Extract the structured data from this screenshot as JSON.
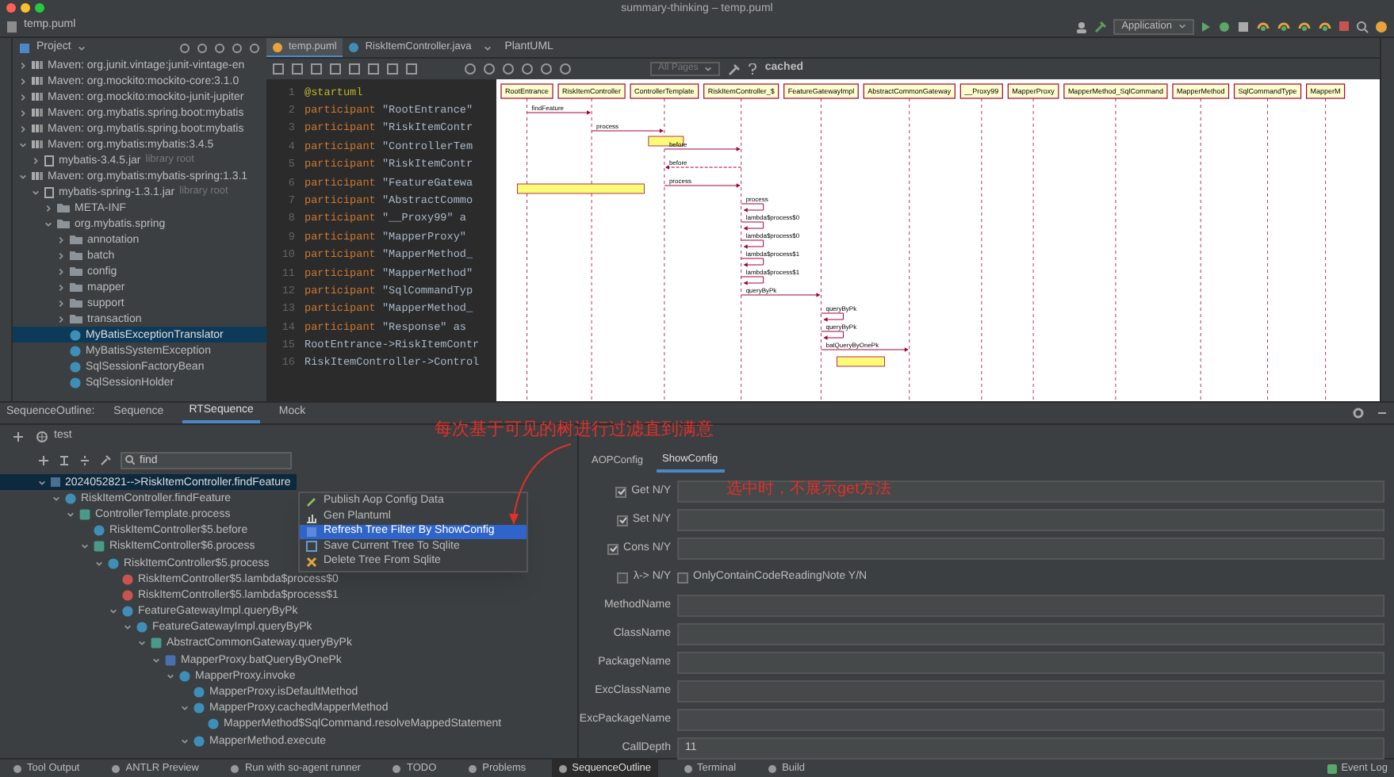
{
  "window": {
    "title": "summary-thinking – temp.puml"
  },
  "navigation_bar": {
    "breadcrumb": "temp.puml",
    "run_configuration": "Application"
  },
  "project_panel": {
    "title": "Project",
    "items": [
      {
        "label": "Maven: org.junit.vintage:junit-vintage-en",
        "kind": "library",
        "expanded": false,
        "selected": false
      },
      {
        "label": "Maven: org.mockito:mockito-core:3.1.0",
        "kind": "library",
        "expanded": false,
        "selected": false
      },
      {
        "label": "Maven: org.mockito:mockito-junit-jupiter",
        "kind": "library",
        "expanded": false,
        "selected": false
      },
      {
        "label": "Maven: org.mybatis.spring.boot:mybatis",
        "kind": "library",
        "expanded": false,
        "selected": false
      },
      {
        "label": "Maven: org.mybatis.spring.boot:mybatis",
        "kind": "library",
        "expanded": false,
        "selected": false
      },
      {
        "label": "Maven: org.mybatis:mybatis:3.4.5",
        "kind": "library",
        "expanded": true,
        "selected": false,
        "children": [
          {
            "label": "mybatis-3.4.5.jar",
            "note": "library root",
            "kind": "jar",
            "expanded": false,
            "selected": false
          }
        ]
      },
      {
        "label": "Maven: org.mybatis:mybatis-spring:1.3.1",
        "kind": "library",
        "expanded": true,
        "selected": false,
        "children": [
          {
            "label": "mybatis-spring-1.3.1.jar",
            "note": "library root",
            "kind": "jar",
            "expanded": true,
            "selected": false,
            "children": [
              {
                "label": "META-INF",
                "kind": "folder",
                "expanded": false,
                "selected": false
              },
              {
                "label": "org.mybatis.spring",
                "kind": "folder",
                "expanded": true,
                "selected": false,
                "children": [
                  {
                    "label": "annotation",
                    "kind": "folder",
                    "expanded": false,
                    "selected": false
                  },
                  {
                    "label": "batch",
                    "kind": "folder",
                    "expanded": false,
                    "selected": false
                  },
                  {
                    "label": "config",
                    "kind": "folder",
                    "expanded": false,
                    "selected": false
                  },
                  {
                    "label": "mapper",
                    "kind": "folder",
                    "expanded": false,
                    "selected": false
                  },
                  {
                    "label": "support",
                    "kind": "folder",
                    "expanded": false,
                    "selected": false
                  },
                  {
                    "label": "transaction",
                    "kind": "folder",
                    "expanded": false,
                    "selected": false
                  },
                  {
                    "label": "MyBatisExceptionTranslator",
                    "kind": "class",
                    "selected": true
                  },
                  {
                    "label": "MyBatisSystemException",
                    "kind": "class",
                    "selected": false
                  },
                  {
                    "label": "SqlSessionFactoryBean",
                    "kind": "class",
                    "selected": false
                  },
                  {
                    "label": "SqlSessionHolder",
                    "kind": "class",
                    "selected": false
                  }
                ]
              }
            ]
          }
        ]
      }
    ]
  },
  "editor": {
    "tabs": [
      {
        "label": "temp.puml",
        "selected": true
      },
      {
        "label": "RiskItemController.java",
        "selected": false
      }
    ],
    "preview_title": "PlantUML",
    "lines": [
      {
        "number": "1",
        "kind": "directive",
        "text": "@startuml"
      },
      {
        "number": "2",
        "kind": "participant",
        "keyword": "participant",
        "text": "\"RootEntrance\""
      },
      {
        "number": "3",
        "kind": "participant",
        "keyword": "participant",
        "text": "\"RiskItemContr"
      },
      {
        "number": "4",
        "kind": "participant",
        "keyword": "participant",
        "text": "\"ControllerTem"
      },
      {
        "number": "5",
        "kind": "participant",
        "keyword": "participant",
        "text": "\"RiskItemContr"
      },
      {
        "number": "6",
        "kind": "participant",
        "keyword": "participant",
        "text": "\"FeatureGatewa"
      },
      {
        "number": "7",
        "kind": "participant",
        "keyword": "participant",
        "text": "\"AbstractCommo"
      },
      {
        "number": "8",
        "kind": "participant",
        "keyword": "participant",
        "text": "\"__Proxy99\" a"
      },
      {
        "number": "9",
        "kind": "participant",
        "keyword": "participant",
        "text": "\"MapperProxy\""
      },
      {
        "number": "10",
        "kind": "participant",
        "keyword": "participant",
        "text": "\"MapperMethod_"
      },
      {
        "number": "11",
        "kind": "participant",
        "keyword": "participant",
        "text": "\"MapperMethod\""
      },
      {
        "number": "12",
        "kind": "participant",
        "keyword": "participant",
        "text": "\"SqlCommandTyp"
      },
      {
        "number": "13",
        "kind": "participant",
        "keyword": "participant",
        "text": "\"MapperMethod_"
      },
      {
        "number": "14",
        "kind": "participant",
        "keyword": "participant",
        "text": "\"Response\" as"
      },
      {
        "number": "15",
        "kind": "plain",
        "text": "RootEntrance->RiskItemContr"
      },
      {
        "number": "16",
        "kind": "plain",
        "text": "RiskItemController->Control"
      }
    ]
  },
  "plantuml": {
    "page_selector": "All Pages",
    "status": "cached",
    "participants": [
      "RootEntrance",
      "RiskItemController",
      "ControllerTemplate",
      "RiskItemController_$",
      "FeatureGatewayImpl",
      "AbstractCommonGateway",
      "__Proxy99",
      "MapperProxy",
      "MapperMethod_SqlCommand",
      "MapperMethod",
      "SqlCommandType",
      "MapperM"
    ],
    "messages": [
      {
        "label": "findFeature"
      },
      {
        "label": "process"
      },
      {
        "label": "before"
      },
      {
        "label": "before"
      },
      {
        "label": "process"
      },
      {
        "label": "process"
      },
      {
        "label": "lambda$process$0"
      },
      {
        "label": "lambda$process$0"
      },
      {
        "label": "lambda$process$1"
      },
      {
        "label": "lambda$process$1"
      },
      {
        "label": "queryByPk"
      },
      {
        "label": "queryByPk"
      },
      {
        "label": "queryByPk"
      },
      {
        "label": "batQueryByOnePk"
      }
    ]
  },
  "bottom_panel": {
    "title": "SequenceOutline:",
    "tabs": [
      {
        "label": "Sequence",
        "selected": false
      },
      {
        "label": "RTSequence",
        "selected": true
      },
      {
        "label": "Mock",
        "selected": false
      }
    ],
    "session": "test",
    "filter": {
      "value": "find"
    },
    "tree": [
      {
        "label": "2024052821-->RiskItemController.findFeature",
        "kind": "root",
        "expanded": true,
        "selected": true,
        "children": [
          {
            "label": "RiskItemController.findFeature",
            "kind": "class",
            "expanded": true,
            "selected": false,
            "children": [
              {
                "label": "ControllerTemplate.process",
                "kind": "abstract",
                "expanded": true,
                "selected": false,
                "children": [
                  {
                    "label": "RiskItemController$5.before",
                    "kind": "class",
                    "selected": false
                  },
                  {
                    "label": "RiskItemController$6.process",
                    "kind": "abstract",
                    "expanded": true,
                    "selected": false,
                    "children": [
                      {
                        "label": "RiskItemController$5.process",
                        "kind": "class",
                        "expanded": true,
                        "selected": false,
                        "children": [
                          {
                            "label": "RiskItemController$5.lambda$process$0",
                            "kind": "lambda",
                            "selected": false
                          },
                          {
                            "label": "RiskItemController$5.lambda$process$1",
                            "kind": "lambda",
                            "selected": false
                          },
                          {
                            "label": "FeatureGatewayImpl.queryByPk",
                            "kind": "class",
                            "expanded": true,
                            "selected": false,
                            "children": [
                              {
                                "label": "FeatureGatewayImpl.queryByPk",
                                "kind": "class",
                                "expanded": true,
                                "selected": false,
                                "children": [
                                  {
                                    "label": "AbstractCommonGateway.queryByPk",
                                    "kind": "abstract",
                                    "expanded": true,
                                    "selected": false,
                                    "children": [
                                      {
                                        "label": "MapperProxy.batQueryByOnePk",
                                        "kind": "interface",
                                        "expanded": true,
                                        "selected": false,
                                        "children": [
                                          {
                                            "label": "MapperProxy.invoke",
                                            "kind": "class",
                                            "expanded": true,
                                            "selected": false,
                                            "children": [
                                              {
                                                "label": "MapperProxy.isDefaultMethod",
                                                "kind": "class",
                                                "selected": false
                                              },
                                              {
                                                "label": "MapperProxy.cachedMapperMethod",
                                                "kind": "class",
                                                "expanded": true,
                                                "selected": false,
                                                "children": [
                                                  {
                                                    "label": "MapperMethod$SqlCommand.resolveMappedStatement",
                                                    "kind": "class",
                                                    "selected": false
                                                  }
                                                ]
                                              },
                                              {
                                                "label": "MapperMethod.execute",
                                                "kind": "class",
                                                "expanded": true,
                                                "selected": false
                                              }
                                            ]
                                          }
                                        ]
                                      }
                                    ]
                                  }
                                ]
                              }
                            ]
                          }
                        ]
                      }
                    ]
                  }
                ]
              }
            ]
          }
        ]
      }
    ],
    "context_menu": [
      {
        "label": "Publish Aop Config Data",
        "kind": "pencil",
        "selected": false
      },
      {
        "label": "Gen Plantuml",
        "kind": "chart",
        "selected": false
      },
      {
        "label": "Refresh Tree Filter By ShowConfig",
        "kind": "refresh",
        "selected": true
      },
      {
        "label": "Save Current Tree To Sqlite",
        "kind": "save",
        "selected": false
      },
      {
        "label": "Delete Tree From Sqlite",
        "kind": "delete",
        "selected": false
      }
    ],
    "config_tabs": [
      {
        "label": "AOPConfig",
        "selected": false
      },
      {
        "label": "ShowConfig",
        "selected": true
      }
    ],
    "form": [
      {
        "kind": "check",
        "label": "Get N/Y",
        "checked": true
      },
      {
        "kind": "check",
        "label": "Set N/Y",
        "checked": true
      },
      {
        "kind": "check",
        "label": "Cons N/Y",
        "checked": true
      },
      {
        "kind": "check_pair",
        "label": "λ-> N/Y",
        "checked": false,
        "option": {
          "label": "OnlyContainCodeReadingNote Y/N",
          "checked": false
        }
      },
      {
        "kind": "text",
        "label": "MethodName"
      },
      {
        "kind": "text",
        "label": "ClassName"
      },
      {
        "kind": "text",
        "label": "PackageName"
      },
      {
        "kind": "text",
        "label": "ExcClassName"
      },
      {
        "kind": "text",
        "label": "ExcPackageName"
      },
      {
        "kind": "text",
        "label": "CallDepth",
        "value": "11"
      }
    ],
    "annotations": [
      "每次基于可见的树进行过滤直到满意",
      "选中时，不展示get方法"
    ]
  },
  "status_bar": {
    "items": [
      {
        "label": "Tool Output",
        "selected": false
      },
      {
        "label": "ANTLR Preview",
        "selected": false
      },
      {
        "label": "Run with so-agent runner",
        "selected": false
      },
      {
        "label": "TODO",
        "selected": false
      },
      {
        "label": "Problems",
        "selected": false
      },
      {
        "label": "SequenceOutline",
        "selected": true
      },
      {
        "label": "Terminal",
        "selected": false
      },
      {
        "label": "Build",
        "selected": false
      }
    ],
    "event_log": "Event Log"
  }
}
